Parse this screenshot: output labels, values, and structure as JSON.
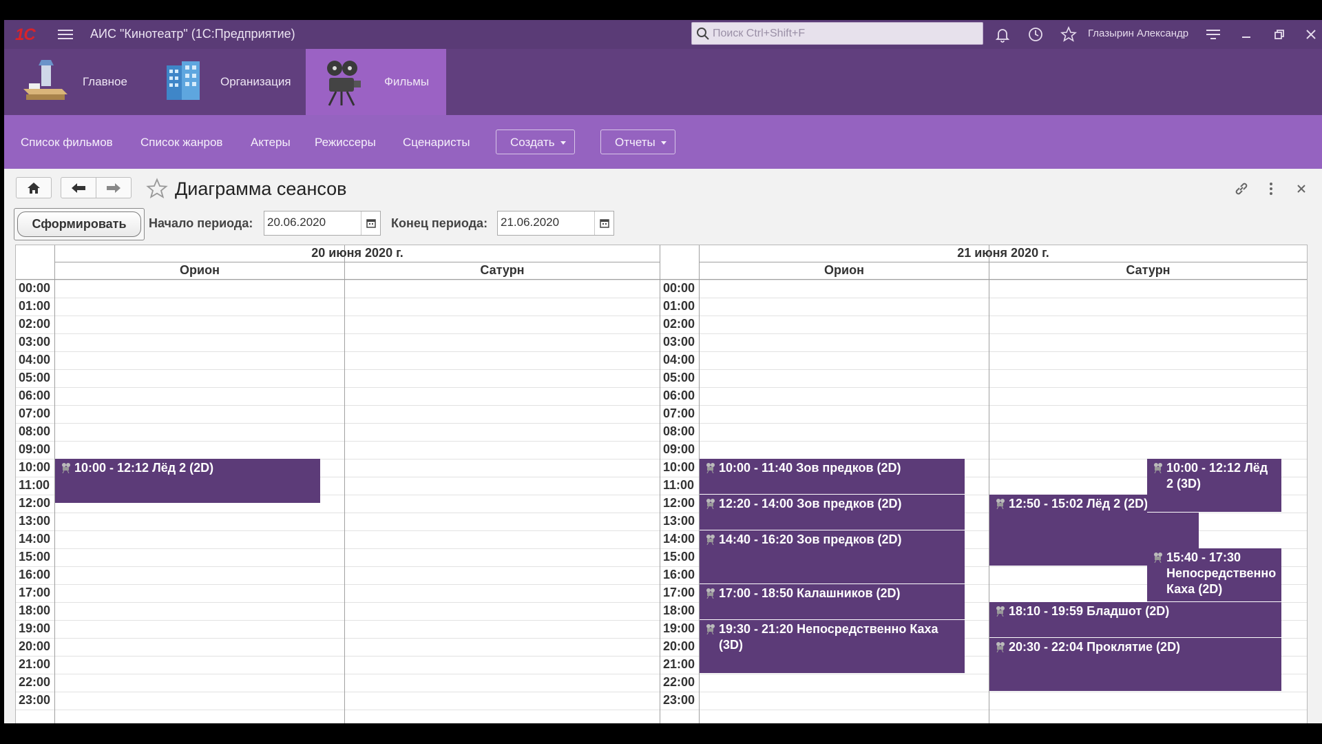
{
  "titlebar": {
    "logo": "1С",
    "title": "АИС \"Кинотеатр\"  (1С:Предприятие)",
    "search_placeholder": "Поиск Ctrl+Shift+F",
    "user": "Глазырин Александр"
  },
  "sections": [
    {
      "label": "Главное",
      "icon": "desk-icon"
    },
    {
      "label": "Организация",
      "icon": "building-icon"
    },
    {
      "label": "Фильмы",
      "icon": "projector-icon",
      "active": true
    }
  ],
  "commands": {
    "items": [
      "Список фильмов",
      "Список жанров",
      "Актеры",
      "Режиссеры",
      "Сценаристы"
    ],
    "create": "Создать",
    "reports": "Отчеты"
  },
  "form": {
    "title": "Диаграмма сеансов",
    "generate": "Сформировать",
    "start_label": "Начало периода:",
    "start_value": "20.06.2020",
    "end_label": "Конец периода:",
    "end_value": "21.06.2020"
  },
  "schedule": {
    "hours": [
      "00:00",
      "01:00",
      "02:00",
      "03:00",
      "04:00",
      "05:00",
      "06:00",
      "07:00",
      "08:00",
      "09:00",
      "10:00",
      "11:00",
      "12:00",
      "13:00",
      "14:00",
      "15:00",
      "16:00",
      "17:00",
      "18:00",
      "19:00",
      "20:00",
      "21:00",
      "22:00",
      "23:00"
    ],
    "days": [
      {
        "date": "20 июня 2020 г.",
        "halls": [
          {
            "name": "Орион",
            "sessions": [
              {
                "text": "10:00 - 12:12 Лёд 2 (2D)",
                "start": 10.0,
                "end": 12.5
              }
            ]
          },
          {
            "name": "Сатурн",
            "sessions": []
          }
        ]
      },
      {
        "date": "21 июня 2020 г.",
        "halls": [
          {
            "name": "Орион",
            "sessions": [
              {
                "text": "10:00 - 11:40 Зов предков (2D)",
                "start": 10.0,
                "end": 12.0
              },
              {
                "text": "12:20 - 14:00 Зов предков (2D)",
                "start": 12.0,
                "end": 14.0
              },
              {
                "text": "14:40 - 16:20 Зов предков (2D)",
                "start": 14.0,
                "end": 17.0
              },
              {
                "text": "17:00 - 18:50 Калашников (2D)",
                "start": 17.0,
                "end": 19.0
              },
              {
                "text": "19:30 - 21:20 Непосредственно Каха (3D)",
                "start": 19.0,
                "end": 22.0
              }
            ]
          },
          {
            "name": "Сатурн",
            "sessions": [
              {
                "text": "12:50 - 15:02 Лёд 2 (2D)",
                "start": 12.0,
                "end": 16.0,
                "col": 0
              },
              {
                "text": "10:00 - 12:12 Лёд 2 (3D)",
                "start": 10.0,
                "end": 13.0,
                "col": 1
              },
              {
                "text": "15:40 - 17:30 Непосредственно Каха (2D)",
                "start": 15.0,
                "end": 18.0,
                "col": 1
              },
              {
                "text": "18:10 - 19:59 Бладшот (2D)",
                "start": 18.0,
                "end": 20.0,
                "col": 2
              },
              {
                "text": "20:30 - 22:04 Проклятие (2D)",
                "start": 20.0,
                "end": 23.0,
                "col": 2
              }
            ]
          }
        ]
      }
    ]
  }
}
